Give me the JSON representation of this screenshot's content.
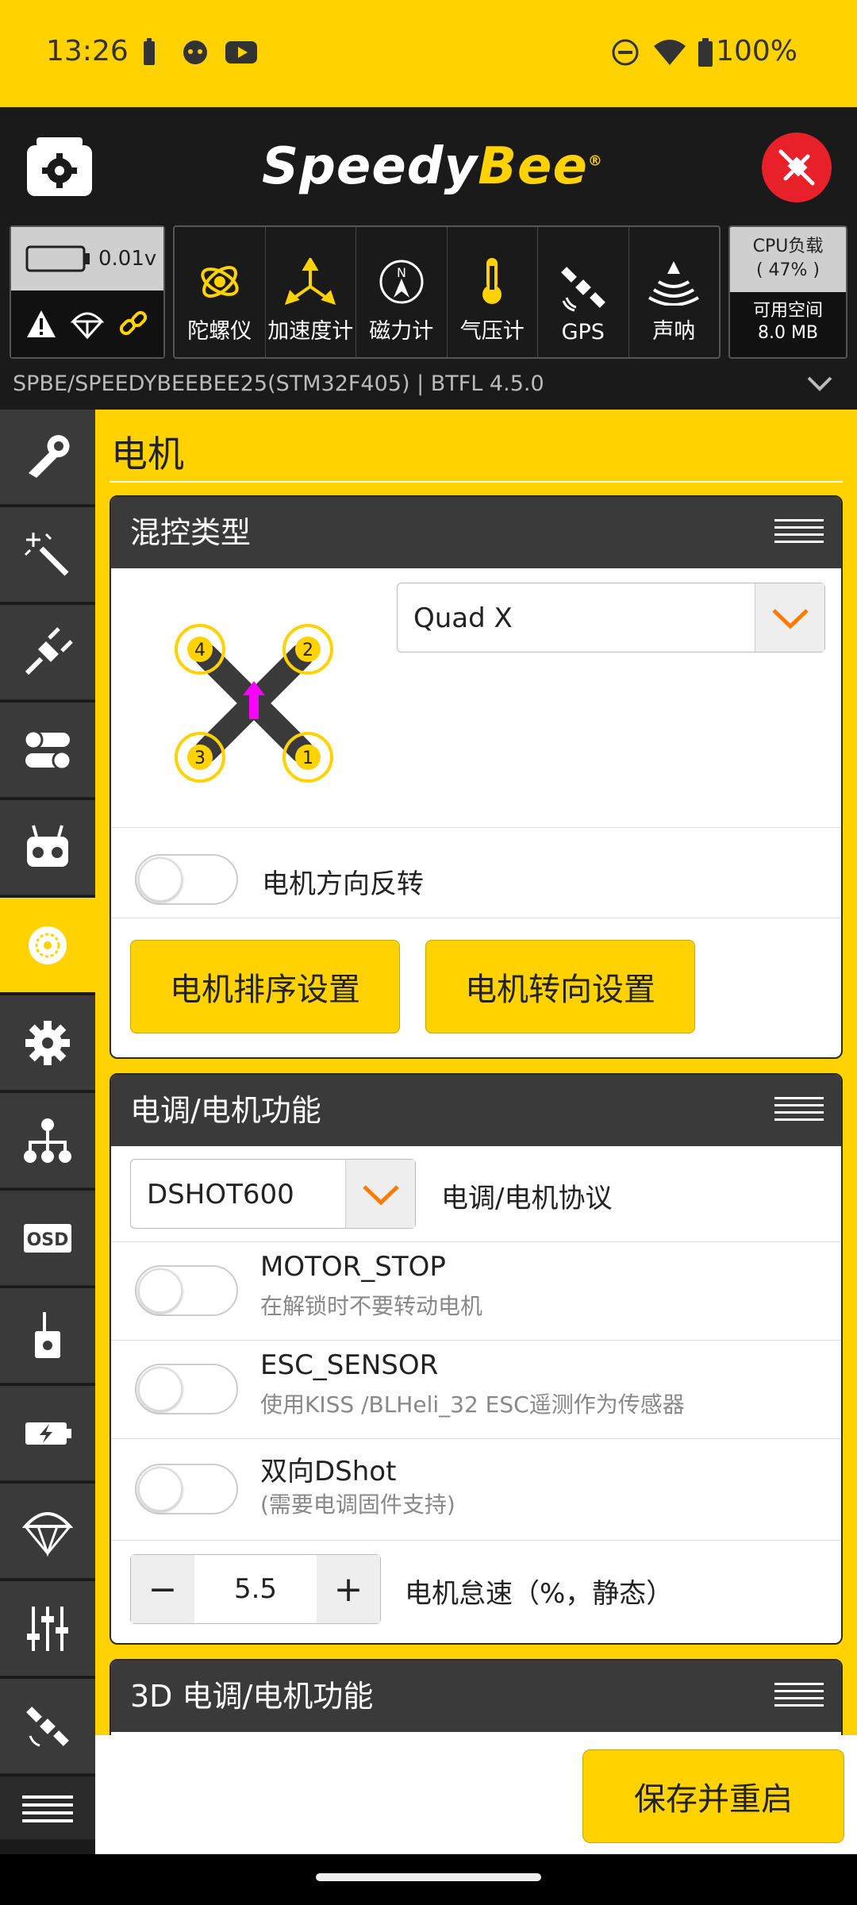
{
  "status_bar": {
    "time": "13:26",
    "battery_pct": "100%"
  },
  "header": {
    "brand_white": "Speedy",
    "brand_yellow": "Bee",
    "registered": "®"
  },
  "battery": {
    "voltage": "0.01v"
  },
  "sensors": [
    {
      "label": "陀螺仪",
      "icon": "gyro-icon"
    },
    {
      "label": "加速度计",
      "icon": "accel-icon"
    },
    {
      "label": "磁力计",
      "icon": "compass-icon"
    },
    {
      "label": "气压计",
      "icon": "thermometer-icon"
    },
    {
      "label": "GPS",
      "icon": "satellite-icon"
    },
    {
      "label": "声呐",
      "icon": "sonar-icon"
    }
  ],
  "cpu": {
    "load_label": "CPU负载",
    "load_value": "( 47% )",
    "space_label": "可用空间",
    "space_value": "8.0 MB"
  },
  "firmware": {
    "text": "SPBE/SPEEDYBEEBEE25(STM32F405)   |   BTFL 4.5.0"
  },
  "page": {
    "title": "电机"
  },
  "mixer": {
    "header": "混控类型",
    "select_value": "Quad X",
    "reverse_label": "电机方向反转",
    "reverse_on": false,
    "order_button": "电机排序设置",
    "direction_button": "电机转向设置",
    "motor_numbers": [
      "4",
      "2",
      "3",
      "1"
    ]
  },
  "esc": {
    "header": "电调/电机功能",
    "protocol_value": "DSHOT600",
    "protocol_label": "电调/电机协议",
    "motor_stop_title": "MOTOR_STOP",
    "motor_stop_desc": "在解锁时不要转动电机",
    "esc_sensor_title": "ESC_SENSOR",
    "esc_sensor_desc": "使用KISS /BLHeli_32 ESC遥测作为传感器",
    "bidir_title": "双向DShot",
    "bidir_desc": "(需要电调固件支持)",
    "idle_value": "5.5",
    "idle_label": "电机怠速（%，静态）",
    "minus": "−",
    "plus": "+"
  },
  "esc3d": {
    "header": "3D 电调/电机功能"
  },
  "save": {
    "label": "保存并重启"
  },
  "sidebar": [
    "wrench-icon",
    "wizard-icon",
    "plug-icon",
    "toggles-icon",
    "receiver-icon",
    "motor-icon",
    "gear-icon",
    "tree-icon",
    "osd-icon",
    "vtx-icon",
    "power-icon",
    "failsafe-icon",
    "tuning-icon",
    "gps-icon",
    "menu-icon"
  ],
  "colors": {
    "accent": "#FFD200",
    "dark": "#1a1a1a",
    "danger": "#e8202a",
    "arrow": "#ff7a00",
    "magenta": "#ff00ff"
  }
}
